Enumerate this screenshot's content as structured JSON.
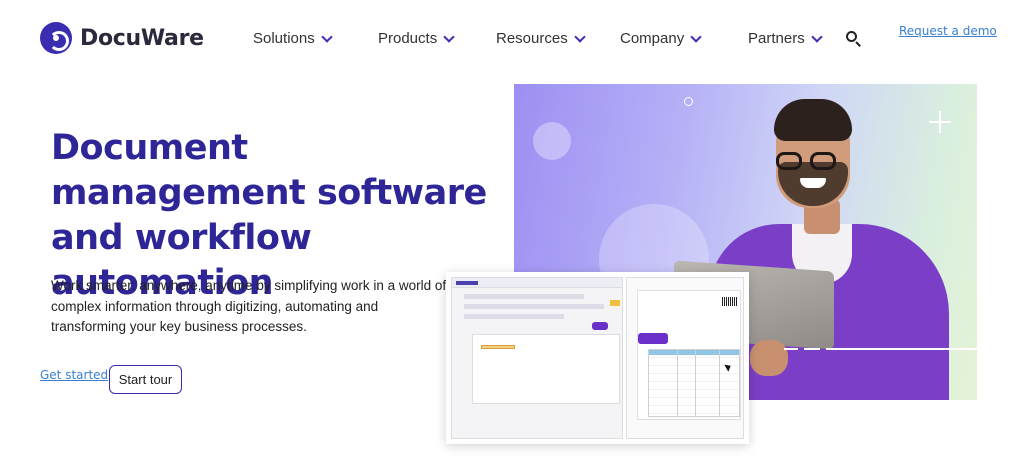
{
  "brand": {
    "name": "DocuWare"
  },
  "nav": {
    "items": [
      {
        "label": "Solutions"
      },
      {
        "label": "Products"
      },
      {
        "label": "Resources"
      },
      {
        "label": "Company"
      },
      {
        "label": "Partners"
      }
    ],
    "search_icon": "search-icon",
    "demo_link": "Request a demo"
  },
  "hero": {
    "title": "Document management software and workflow automation",
    "description": "Work smarter: anywhere, anytime by simplifying work in a world of complex information through digitizing, automating and transforming your key business processes.",
    "get_started": "Get started",
    "start_tour": "Start tour"
  },
  "colors": {
    "brand_purple": "#2e2596",
    "accent": "#3b2db2",
    "link": "#3a7fd0"
  }
}
